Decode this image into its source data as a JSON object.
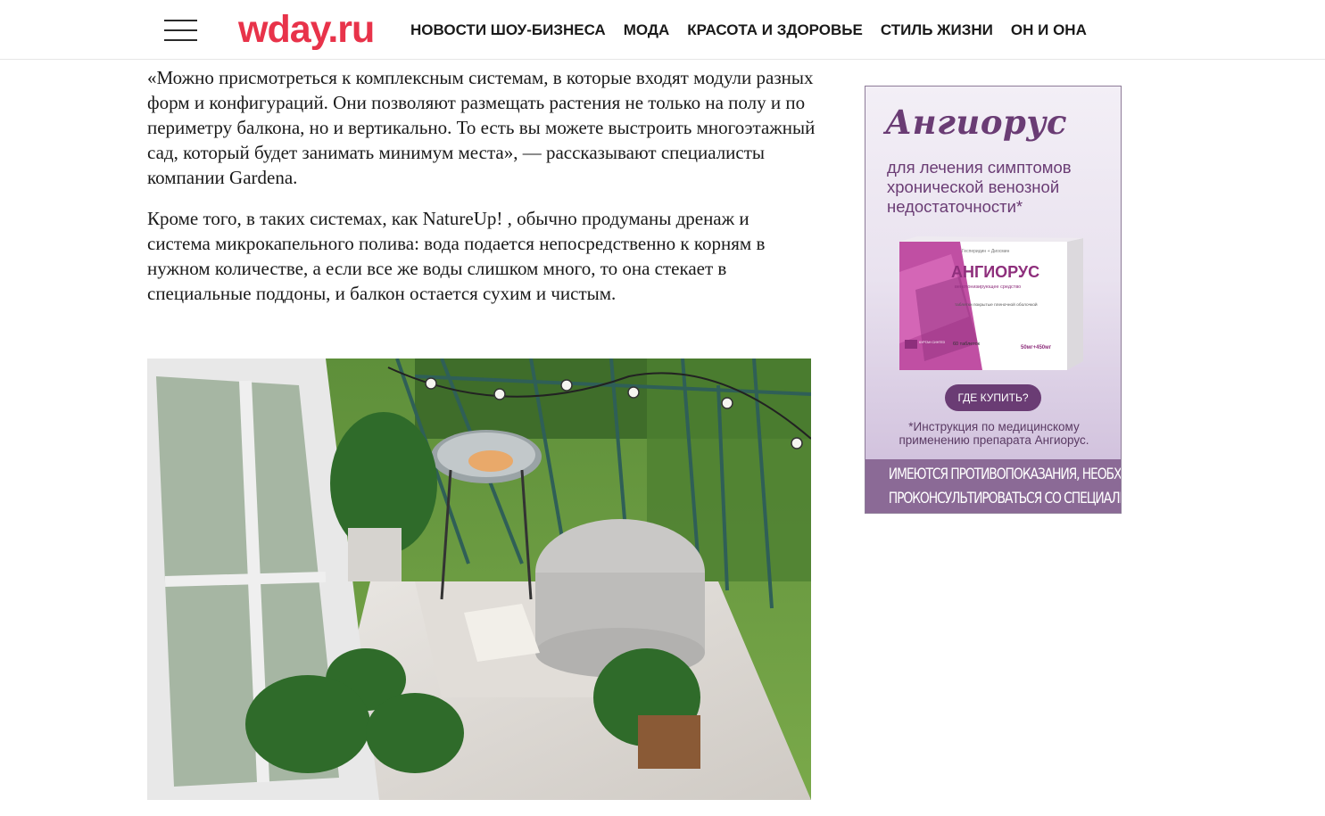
{
  "header": {
    "logo": "wday.ru",
    "nav": [
      "НОВОСТИ ШОУ-БИЗНЕСА",
      "МОДА",
      "КРАСОТА И ЗДОРОВЬЕ",
      "СТИЛЬ ЖИЗНИ",
      "ОН И ОНА"
    ]
  },
  "article": {
    "paragraphs": [
      "«Можно присмотреться к комплексным системам, в которые входят модули разных форм и конфигураций. Они позволяют размещать растения не только на полу и по периметру балкона, но и вертикально. То есть вы можете выстроить многоэтажный сад, который будет занимать минимум места», — рассказывают специалисты компании Gardena.",
      "Кроме того, в таких системах, как NatureUp! , обычно продуманы дренаж и система микрокапельного полива: вода подается непосредственно к корням в нужном количестве, а если все же воды слишком много, то она стекает в специальные поддоны, и балкон остается сухим и чистым."
    ]
  },
  "ad": {
    "brand": "Ангиорус",
    "subtitle": "для лечения симптомов хронической венозной недостаточности*",
    "box_small_top": "Гесперидин + Диосмин",
    "box_name": "АНГИОРУС",
    "box_desc": "венотонизирующее средство",
    "box_form": "таблетки покрытые пленочной оболочкой",
    "box_count": "60 таблеток",
    "box_dose": "50мг+450мг",
    "box_maker": "КУРГАН СИНТЕЗ",
    "button": "ГДЕ КУПИТЬ?",
    "note": "*Инструкция по медицинскому применению препарата Ангиорус.",
    "warning_line1": "ИМЕЮТСЯ ПРОТИВОПОКАЗАНИЯ, НЕОБХОДИМО",
    "warning_line2": "ПРОКОНСУЛЬТИРОВАТЬСЯ СО СПЕЦИАЛИСТОМ"
  },
  "colors": {
    "logo": "#e8334a",
    "ad_accent": "#6a3c74"
  }
}
